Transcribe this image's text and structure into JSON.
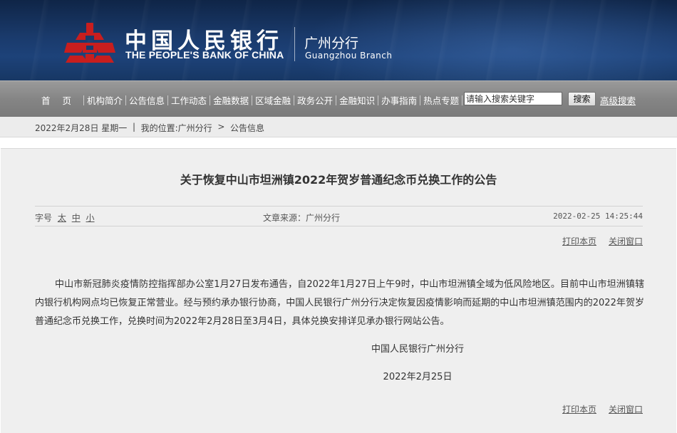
{
  "header": {
    "bank_name_cn": "中国人民银行",
    "bank_name_en": "THE PEOPLE'S BANK OF CHINA",
    "branch_cn": "广州分行",
    "branch_en": "Guangzhou  Branch",
    "colors": {
      "banner": "#1a3a6b",
      "logo_red": "#c81e1e"
    },
    "logo_icon": "pboc-emblem-icon"
  },
  "nav": {
    "items": [
      "首页",
      "机构简介",
      "公告信息",
      "工作动态",
      "金融数据",
      "区域金融",
      "政务公开",
      "金融知识",
      "办事指南",
      "热点专题"
    ],
    "search_placeholder": "请输入搜索关键字",
    "search_button": "搜索",
    "advanced_search": "高级搜索"
  },
  "breadcrumb": {
    "date": "2022年2月28日",
    "weekday": "星期一",
    "sep": "|",
    "location_label": "我的位置:",
    "path": [
      "广州分行",
      "公告信息"
    ],
    "arrow": ">"
  },
  "article": {
    "title": "关于恢复中山市坦洲镇2022年贺岁普通纪念币兑换工作的公告",
    "font_size_label": "字号",
    "font_sizes": [
      "太",
      "中",
      "小"
    ],
    "source_label": "文章来源：",
    "source": "广州分行",
    "published": "2022-02-25 14:25:44",
    "print_label": "打印本页",
    "close_label": "关闭窗口",
    "body": "中山市新冠肺炎疫情防控指挥部办公室1月27日发布通告，自2022年1月27日上午9时，中山市坦洲镇全域为低风险地区。目前中山市坦洲镇辖内银行机构网点均已恢复正常营业。经与预约承办银行协商，中国人民银行广州分行决定恢复因疫情影响而延期的中山市坦洲镇范围内的2022年贺岁普通纪念币兑换工作，兑换时间为2022年2月28日至3月4日，具体兑换安排详见承办银行网站公告。",
    "signature_org": "中国人民银行广州分行",
    "signature_date": "2022年2月25日"
  }
}
